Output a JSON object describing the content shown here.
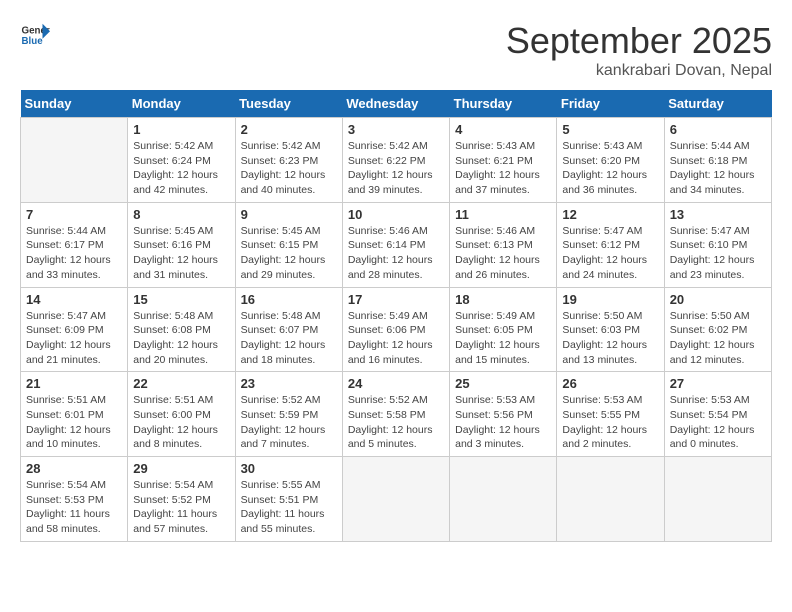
{
  "logo": {
    "text_general": "General",
    "text_blue": "Blue"
  },
  "title": "September 2025",
  "subtitle": "kankrabari Dovan, Nepal",
  "weekdays": [
    "Sunday",
    "Monday",
    "Tuesday",
    "Wednesday",
    "Thursday",
    "Friday",
    "Saturday"
  ],
  "weeks": [
    [
      {
        "day": "",
        "info": ""
      },
      {
        "day": "1",
        "info": "Sunrise: 5:42 AM\nSunset: 6:24 PM\nDaylight: 12 hours\nand 42 minutes."
      },
      {
        "day": "2",
        "info": "Sunrise: 5:42 AM\nSunset: 6:23 PM\nDaylight: 12 hours\nand 40 minutes."
      },
      {
        "day": "3",
        "info": "Sunrise: 5:42 AM\nSunset: 6:22 PM\nDaylight: 12 hours\nand 39 minutes."
      },
      {
        "day": "4",
        "info": "Sunrise: 5:43 AM\nSunset: 6:21 PM\nDaylight: 12 hours\nand 37 minutes."
      },
      {
        "day": "5",
        "info": "Sunrise: 5:43 AM\nSunset: 6:20 PM\nDaylight: 12 hours\nand 36 minutes."
      },
      {
        "day": "6",
        "info": "Sunrise: 5:44 AM\nSunset: 6:18 PM\nDaylight: 12 hours\nand 34 minutes."
      }
    ],
    [
      {
        "day": "7",
        "info": "Sunrise: 5:44 AM\nSunset: 6:17 PM\nDaylight: 12 hours\nand 33 minutes."
      },
      {
        "day": "8",
        "info": "Sunrise: 5:45 AM\nSunset: 6:16 PM\nDaylight: 12 hours\nand 31 minutes."
      },
      {
        "day": "9",
        "info": "Sunrise: 5:45 AM\nSunset: 6:15 PM\nDaylight: 12 hours\nand 29 minutes."
      },
      {
        "day": "10",
        "info": "Sunrise: 5:46 AM\nSunset: 6:14 PM\nDaylight: 12 hours\nand 28 minutes."
      },
      {
        "day": "11",
        "info": "Sunrise: 5:46 AM\nSunset: 6:13 PM\nDaylight: 12 hours\nand 26 minutes."
      },
      {
        "day": "12",
        "info": "Sunrise: 5:47 AM\nSunset: 6:12 PM\nDaylight: 12 hours\nand 24 minutes."
      },
      {
        "day": "13",
        "info": "Sunrise: 5:47 AM\nSunset: 6:10 PM\nDaylight: 12 hours\nand 23 minutes."
      }
    ],
    [
      {
        "day": "14",
        "info": "Sunrise: 5:47 AM\nSunset: 6:09 PM\nDaylight: 12 hours\nand 21 minutes."
      },
      {
        "day": "15",
        "info": "Sunrise: 5:48 AM\nSunset: 6:08 PM\nDaylight: 12 hours\nand 20 minutes."
      },
      {
        "day": "16",
        "info": "Sunrise: 5:48 AM\nSunset: 6:07 PM\nDaylight: 12 hours\nand 18 minutes."
      },
      {
        "day": "17",
        "info": "Sunrise: 5:49 AM\nSunset: 6:06 PM\nDaylight: 12 hours\nand 16 minutes."
      },
      {
        "day": "18",
        "info": "Sunrise: 5:49 AM\nSunset: 6:05 PM\nDaylight: 12 hours\nand 15 minutes."
      },
      {
        "day": "19",
        "info": "Sunrise: 5:50 AM\nSunset: 6:03 PM\nDaylight: 12 hours\nand 13 minutes."
      },
      {
        "day": "20",
        "info": "Sunrise: 5:50 AM\nSunset: 6:02 PM\nDaylight: 12 hours\nand 12 minutes."
      }
    ],
    [
      {
        "day": "21",
        "info": "Sunrise: 5:51 AM\nSunset: 6:01 PM\nDaylight: 12 hours\nand 10 minutes."
      },
      {
        "day": "22",
        "info": "Sunrise: 5:51 AM\nSunset: 6:00 PM\nDaylight: 12 hours\nand 8 minutes."
      },
      {
        "day": "23",
        "info": "Sunrise: 5:52 AM\nSunset: 5:59 PM\nDaylight: 12 hours\nand 7 minutes."
      },
      {
        "day": "24",
        "info": "Sunrise: 5:52 AM\nSunset: 5:58 PM\nDaylight: 12 hours\nand 5 minutes."
      },
      {
        "day": "25",
        "info": "Sunrise: 5:53 AM\nSunset: 5:56 PM\nDaylight: 12 hours\nand 3 minutes."
      },
      {
        "day": "26",
        "info": "Sunrise: 5:53 AM\nSunset: 5:55 PM\nDaylight: 12 hours\nand 2 minutes."
      },
      {
        "day": "27",
        "info": "Sunrise: 5:53 AM\nSunset: 5:54 PM\nDaylight: 12 hours\nand 0 minutes."
      }
    ],
    [
      {
        "day": "28",
        "info": "Sunrise: 5:54 AM\nSunset: 5:53 PM\nDaylight: 11 hours\nand 58 minutes."
      },
      {
        "day": "29",
        "info": "Sunrise: 5:54 AM\nSunset: 5:52 PM\nDaylight: 11 hours\nand 57 minutes."
      },
      {
        "day": "30",
        "info": "Sunrise: 5:55 AM\nSunset: 5:51 PM\nDaylight: 11 hours\nand 55 minutes."
      },
      {
        "day": "",
        "info": ""
      },
      {
        "day": "",
        "info": ""
      },
      {
        "day": "",
        "info": ""
      },
      {
        "day": "",
        "info": ""
      }
    ]
  ]
}
